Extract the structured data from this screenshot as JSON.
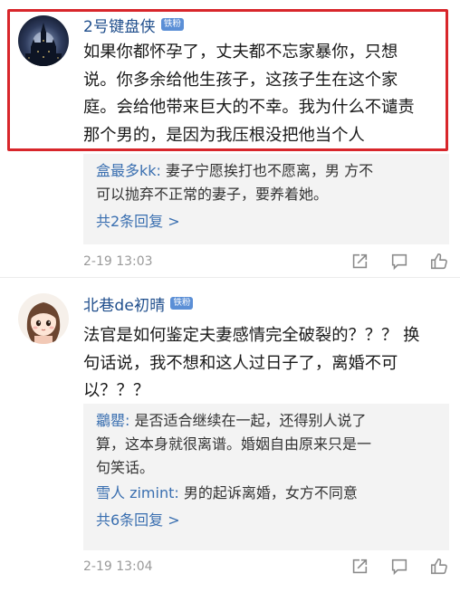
{
  "comments": [
    {
      "username": "2号键盘侠",
      "badge": "铁粉",
      "avatar_icon": "castle-night-icon",
      "lines": [
        "如果你都怀孕了，丈夫都不忘家暴你，只想",
        "说。你多余给他生孩子，这孩子生在这个家",
        "庭。会给他带来巨大的不幸。我为什么不谴责",
        "那个男的，是因为我压根没把他当个人"
      ],
      "replies": [
        {
          "name": "盒最多kk:",
          "lines": [
            " 妻子宁愿挨打也不愿离，男 方不",
            "可以抛弃不正常的妻子，要养着她。"
          ]
        }
      ],
      "reply_count": "共2条回复 >",
      "time": "2-19 13:03"
    },
    {
      "username": "北巷de初晴",
      "badge": "铁粉",
      "avatar_icon": "cartoon-girl-icon",
      "lines": [
        "法官是如何鉴定夫妻感情完全破裂的？？？ 换",
        "句话说，我不想和这人过日子了，离婚不可",
        "以？？？"
      ],
      "replies": [
        {
          "name": "鸘罌:",
          "lines": [
            " 是否适合继续在一起，还得别人说了",
            "算，这本身就很离谱。婚姻自由原来只是一",
            "句笑话。"
          ]
        },
        {
          "name": "雪人 zimint:",
          "lines": [
            " 男的起诉离婚，女方不同意"
          ]
        }
      ],
      "reply_count": "共6条回复 >",
      "time": "2-19 13:04"
    }
  ],
  "action_icons": [
    "share-icon",
    "comment-icon",
    "like-icon"
  ],
  "colors": {
    "highlight": "#d8262b",
    "link": "#3a6fb0",
    "username": "#1f4e8c",
    "badge": "#5b8fd6"
  }
}
